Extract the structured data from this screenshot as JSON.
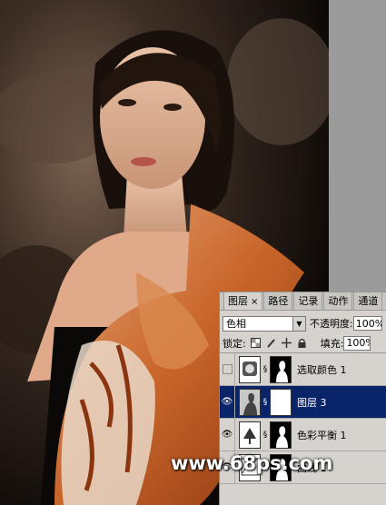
{
  "layers_panel": {
    "tabs": [
      {
        "label": "图层",
        "active": true
      },
      {
        "label": "路径",
        "active": false
      },
      {
        "label": "记录",
        "active": false
      },
      {
        "label": "动作",
        "active": false
      },
      {
        "label": "通道",
        "active": false
      }
    ],
    "close_glyph": "×",
    "blend_mode": "色相",
    "opacity_label": "不透明度:",
    "opacity_value": "100%",
    "lock_label": "锁定:",
    "fill_label": "填充:",
    "fill_value": "100%",
    "layers": [
      {
        "name": "选取颜色 1",
        "visible": false,
        "selected": false,
        "thumb": "adjustment-selective-color"
      },
      {
        "name": "图层 3",
        "visible": true,
        "selected": true,
        "thumb": "pixel"
      },
      {
        "name": "色彩平衡 1",
        "visible": true,
        "selected": false,
        "thumb": "adjustment-color-balance"
      },
      {
        "name": "曲线 1",
        "visible": true,
        "selected": false,
        "thumb": "adjustment-curves"
      }
    ]
  },
  "watermark": "www.68ps.com",
  "colors": {
    "selected_layer_bg": "#0a246a",
    "panel_bg": "#d6d3ce",
    "scarf": "#c8652a"
  }
}
